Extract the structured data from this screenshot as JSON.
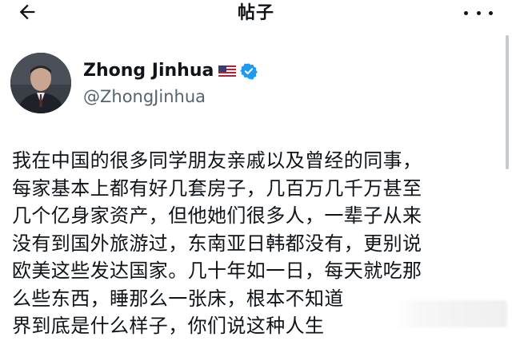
{
  "header": {
    "title": "帖子",
    "back_icon": "arrow-left-icon",
    "more_icon": "more-horizontal-icon"
  },
  "author": {
    "display_name": "Zhong Jinhua",
    "flag_icon": "us-flag-icon",
    "verified_icon": "verified-badge-icon",
    "verified_color": "#1d9bf0",
    "handle": "@ZhongJinhua"
  },
  "post": {
    "lines": [
      "我在中国的很多同学朋友亲戚以及曾经的同事，",
      "每家基本上都有好几套房子，几百万几千万甚至",
      "几个亿身家资产，但他她们很多人，一辈子从来",
      "没有到国外旅游过，东南亚日韩都没有，更别说",
      "欧美这些发达国家。几十年如一日，每天就吃那",
      "么些东西，睡那么一张床，根本不知道",
      "界到底是什么样子，你们说这种人生"
    ]
  },
  "colors": {
    "text": "#0f1419",
    "secondary_text": "#536471",
    "background": "#ffffff"
  }
}
